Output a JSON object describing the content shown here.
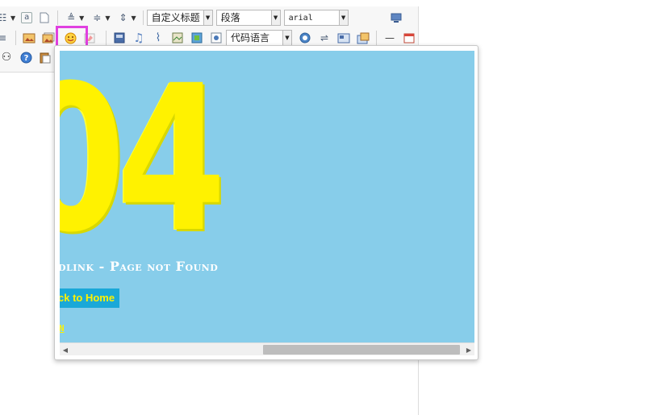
{
  "toolbar": {
    "custom_title_value": "自定义标题",
    "paragraph_value": "段落",
    "font_value": "arial",
    "code_language_value": "代码语言",
    "link_glyph": "a"
  },
  "preview": {
    "big_text": "04",
    "error_title": "dlink - Page not Found",
    "home_button": "ck to Home",
    "small_link": "N"
  },
  "colors": {
    "preview_bg": "#87cdea",
    "accent_yellow": "#fff200",
    "button_bg": "#1aa8d8",
    "highlight": "#e040e0"
  },
  "icons": [
    "unordered-list-icon",
    "link-icon",
    "page-icon",
    "row-spacing-top-icon",
    "row-spacing-bottom-icon",
    "line-height-icon",
    "fullscreen-icon",
    "align-icon",
    "image-icon",
    "multi-image-icon",
    "emotion-icon",
    "scrawl-icon",
    "video-icon",
    "music-icon",
    "attachment-icon",
    "map-icon",
    "gmap-icon",
    "frame-icon",
    "insert-code-icon",
    "page-break-icon",
    "template-icon",
    "background-icon",
    "horizontal-rule-icon",
    "date-icon",
    "search-replace-icon",
    "help-icon",
    "paste-icon"
  ]
}
